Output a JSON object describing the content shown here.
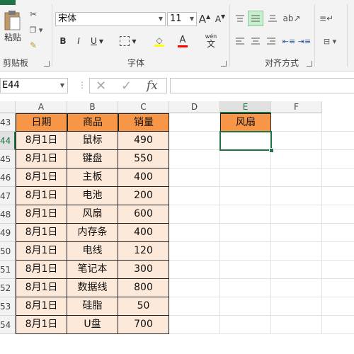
{
  "ribbon": {
    "clipboard": {
      "paste_label": "粘贴",
      "group_label": "剪贴板"
    },
    "font": {
      "font_name": "宋体",
      "font_size": "11",
      "grow_glyph": "A",
      "shrink_glyph": "A",
      "bold": "B",
      "italic": "I",
      "underline": "U",
      "font_color_glyph": "A",
      "wen_glyph": "wén",
      "wen_char": "文",
      "group_label": "字体"
    },
    "alignment": {
      "group_label": "对齐方式"
    }
  },
  "formula_bar": {
    "name_box": "E44",
    "fx_label": "fx",
    "formula": ""
  },
  "sheet": {
    "columns": [
      "A",
      "B",
      "C",
      "D",
      "E",
      "F"
    ],
    "rows": [
      "43",
      "44",
      "45",
      "46",
      "47",
      "48",
      "49",
      "50",
      "51",
      "52",
      "53",
      "54"
    ],
    "table_headers": [
      "日期",
      "商品",
      "销量"
    ],
    "table_rows": [
      [
        "8月1日",
        "鼠标",
        "490"
      ],
      [
        "8月1日",
        "键盘",
        "550"
      ],
      [
        "8月1日",
        "主板",
        "400"
      ],
      [
        "8月1日",
        "电池",
        "200"
      ],
      [
        "8月1日",
        "风扇",
        "600"
      ],
      [
        "8月1日",
        "内存条",
        "400"
      ],
      [
        "8月1日",
        "电线",
        "120"
      ],
      [
        "8月1日",
        "笔记本",
        "300"
      ],
      [
        "8月1日",
        "数据线",
        "800"
      ],
      [
        "8月1日",
        "硅脂",
        "50"
      ],
      [
        "8月1日",
        "U盘",
        "700"
      ]
    ],
    "e43_value": "风扇",
    "selected_cell": "E44"
  },
  "colors": {
    "header_fill": "#f79646",
    "data_fill": "#fde9d9",
    "excel_green": "#217346"
  }
}
